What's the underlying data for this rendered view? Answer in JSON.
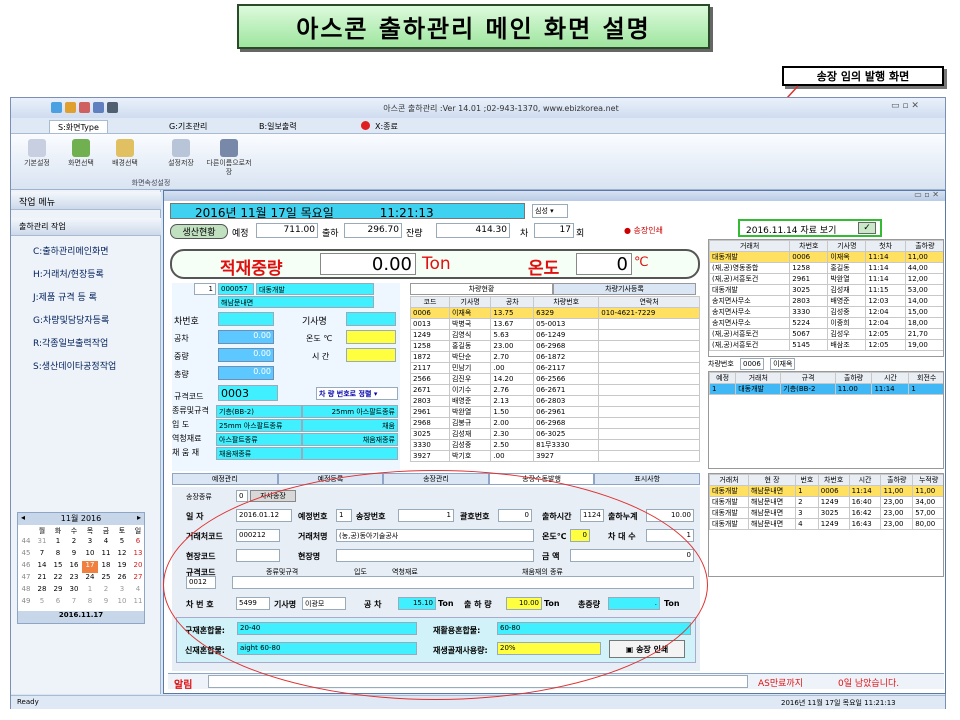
{
  "page_title": "아스콘 출하관리 메인 화면 설명",
  "note_label": "송장 임의 발행 화면",
  "window_title": "아스콘 출하관리 :Ver 14.01 ;02-943-1370, www.ebizkorea.net",
  "menu": [
    "S:화면Type",
    "G:기초관리",
    "B:일보출력",
    "X:종료"
  ],
  "ribbon": {
    "buttons": [
      "기본설정",
      "화면선택",
      "배경선택",
      "설정저장",
      "다른이름으로저장"
    ],
    "group": "화면속성설정"
  },
  "sidebar": {
    "header": "작업 메뉴",
    "group": "출하관리 작업",
    "items": [
      "C:출하관리메인화면",
      "H:거래처/현장등록",
      "J:제품 규격 등 록",
      "G:차량및담당자등록",
      "R:각종일보출력작업",
      "S:생산데이타공정작업"
    ]
  },
  "calendar": {
    "title": "11월 2016",
    "days": [
      "월",
      "화",
      "수",
      "목",
      "금",
      "토",
      "일"
    ],
    "weeks": [
      [
        "44",
        "31",
        "1",
        "2",
        "3",
        "4",
        "5",
        "6"
      ],
      [
        "45",
        "7",
        "8",
        "9",
        "10",
        "11",
        "12",
        "13"
      ],
      [
        "46",
        "14",
        "15",
        "16",
        "17",
        "18",
        "19",
        "20"
      ],
      [
        "47",
        "21",
        "22",
        "23",
        "24",
        "25",
        "26",
        "27"
      ],
      [
        "48",
        "28",
        "29",
        "30",
        "1",
        "2",
        "3",
        "4"
      ],
      [
        "49",
        "5",
        "6",
        "7",
        "8",
        "9",
        "10",
        "11"
      ]
    ],
    "today": "2016.11.17"
  },
  "main": {
    "date": "2016년 11월 17일 목요일",
    "time": "11:21:13",
    "combo": "심성",
    "status": "생산현황",
    "plan_label": "예정",
    "plan": "711.00",
    "out_label": "출하",
    "out": "296.70",
    "rest_label": "잔량",
    "rest": "414.30",
    "car_label": "차",
    "car": "17",
    "hoe": "회",
    "print_label": "송장인쇄",
    "view_date": "2016.11.14 자료 보기",
    "load_label": "적재중량",
    "load": "0.00",
    "ton": "Ton",
    "temp_label": "온도",
    "temp": "0",
    "tc": "℃"
  },
  "form": {
    "no": "1",
    "cust_code": "000057",
    "cust": "대동개발",
    "site": "해남문내면",
    "car_no": "차번호",
    "driver": "기사명",
    "empty": "공차",
    "empty_v": "0.00",
    "temp": "온도 ℃",
    "weight": "중량",
    "weight_v": "0.00",
    "time": "시 간",
    "total": "총량",
    "total_v": "0.00",
    "spec_code": "규격코드",
    "spec_v": "0003",
    "sort_btn": "차 량 번호로 정렬",
    "rows": [
      [
        "종류및규격",
        "기층(BB-2)",
        "25mm 아스팔트종류"
      ],
      [
        "입  도",
        "25mm 아스팔트종류",
        "채움"
      ],
      [
        "역청재료",
        "아스팔트종류",
        "채움재종류"
      ],
      [
        "채 움 재",
        "채움재종류",
        ""
      ]
    ]
  },
  "tabs_top": [
    "차량현황",
    "차량기사등록"
  ],
  "cars": {
    "head": [
      "코드",
      "기사명",
      "공차",
      "차량번호",
      "연락처"
    ],
    "rows": [
      [
        "0006",
        "이재옥",
        "13.75",
        "6329",
        "010-4621-7229"
      ],
      [
        "0013",
        "박병국",
        "13.67",
        "05-0013",
        ""
      ],
      [
        "1249",
        "김영식",
        "5.63",
        "06-1249",
        ""
      ],
      [
        "1258",
        "홍길동",
        "23.00",
        "06-2968",
        ""
      ],
      [
        "1872",
        "박단순",
        "2.70",
        "06-1872",
        ""
      ],
      [
        "2117",
        "민남기",
        ".00",
        "06-2117",
        ""
      ],
      [
        "2566",
        "김진우",
        "14.20",
        "06-2566",
        ""
      ],
      [
        "2671",
        "이기수",
        "2.76",
        "06-2671",
        ""
      ],
      [
        "2803",
        "배영준",
        "2.13",
        "06-2803",
        ""
      ],
      [
        "2961",
        "박완열",
        "1.50",
        "06-2961",
        ""
      ],
      [
        "2968",
        "김봉규",
        "2.00",
        "06-2968",
        ""
      ],
      [
        "3025",
        "김성재",
        "2.30",
        "06-3025",
        ""
      ],
      [
        "3330",
        "김성중",
        "2.50",
        "81무3330",
        ""
      ],
      [
        "3927",
        "박기호",
        ".00",
        "3927",
        ""
      ]
    ]
  },
  "right_top": {
    "head": [
      "거래처",
      "차번호",
      "기사명",
      "첫차",
      "출하량"
    ],
    "rows": [
      [
        "대동개발",
        "0006",
        "이재옥",
        "11:14",
        "11,00"
      ],
      [
        "(재,공)영동종합",
        "1258",
        "홍길동",
        "11:14",
        "44,00"
      ],
      [
        "(재,공)서흥토건",
        "2961",
        "박완열",
        "11:14",
        "12,00"
      ],
      [
        "대동개발",
        "3025",
        "김성재",
        "11:15",
        "53,00"
      ],
      [
        "송지면사무소",
        "2803",
        "배영준",
        "12:03",
        "14,00"
      ],
      [
        "송지면사무소",
        "3330",
        "김성중",
        "12:04",
        "15,00"
      ],
      [
        "송지면사무소",
        "5224",
        "이중희",
        "12:04",
        "18,00"
      ],
      [
        "(재,공)서흥토건",
        "5067",
        "김성우",
        "12:05",
        "21,70"
      ],
      [
        "(재,공)서흥토건",
        "5145",
        "배삼조",
        "12:05",
        "19,00"
      ]
    ],
    "car_label": "차량번호",
    "car_no": "0006",
    "car_name": "이재옥",
    "sub_head": [
      "예정",
      "거래처",
      "규격",
      "출하량",
      "시간",
      "회전수"
    ],
    "sub_row": [
      "1",
      "대동개발",
      "기층(BB-2",
      "11.00",
      "11:14",
      "1"
    ]
  },
  "right_bot": {
    "head": [
      "거래처",
      "현 장",
      "번호",
      "차번호",
      "시간",
      "출하량",
      "누적량"
    ],
    "rows": [
      [
        "대동개발",
        "해남문내면",
        "1",
        "0006",
        "11:14",
        "11,00",
        "11,00"
      ],
      [
        "대동개발",
        "해남문내면",
        "2",
        "1249",
        "16:40",
        "23,00",
        "34,00"
      ],
      [
        "대동개발",
        "해남문내면",
        "3",
        "3025",
        "16:42",
        "23,00",
        "57,00"
      ],
      [
        "대동개발",
        "해남문내면",
        "4",
        "1249",
        "16:43",
        "23,00",
        "80,00"
      ]
    ]
  },
  "tabs_bot": [
    "예정관리",
    "예정등록",
    "송장관리",
    "송장수동발행",
    "표시사항"
  ],
  "invoice": {
    "kind_label": "송장종류",
    "kind_no": "0",
    "kind": "자사송장",
    "date_label": "일   자",
    "date": "2016.01.12",
    "plan_no_label": "예정번호",
    "plan_no": "1",
    "inv_no_label": "송장번호",
    "inv_no": "1",
    "rel_no_label": "괄호번호",
    "rel_no": "0",
    "out_time_label": "출하시간",
    "out_time": "1124",
    "out_total_label": "출하누계",
    "out_total": "10.00",
    "cust_code_label": "거래처코드",
    "cust_code": "000212",
    "cust_label": "거래처명",
    "cust": "(농,공)동아기술공사",
    "temp_label": "온도℃",
    "temp": "0",
    "cnt_label": "차 대 수",
    "cnt": "1",
    "site_code_label": "현장코드",
    "site_label": "현장명",
    "amt_label": "금  액",
    "amt": "0",
    "spec_label": "규격코드",
    "spec_head": [
      "종류및규격",
      "입도",
      "역청재료",
      "채움재의 종류"
    ],
    "spec_code": "0012",
    "car_label": "차 번 호",
    "car": "5499",
    "driver_label": "기사명",
    "driver": "이광모",
    "empty_label": "공 차",
    "empty": "15.10",
    "ton1": "Ton",
    "qty_label": "출 하 량",
    "qty": "10.00",
    "ton2": "Ton",
    "total_label": "총중량",
    "total": ".",
    "ton3": "Ton",
    "mix1_label": "구재혼합물:",
    "mix1": "20-40",
    "mix2_label": "재활용혼합물:",
    "mix2": "60-80",
    "mix3_label": "신재혼합물:",
    "mix3": "aight 60-80",
    "mix4_label": "재생골재사용량:",
    "mix4": "20%",
    "print_btn": "송장 인쇄"
  },
  "alarm_label": "알림",
  "as_text": "AS만료까지",
  "as_days": "0일 남았습니다.",
  "status_bar": {
    "left": "Ready",
    "right": "2016년 11월 17일 목요일 11:21:13"
  },
  "colors": {
    "accent": "#3fd2f0",
    "highlight": "#ffff40",
    "red": "#e01010"
  }
}
